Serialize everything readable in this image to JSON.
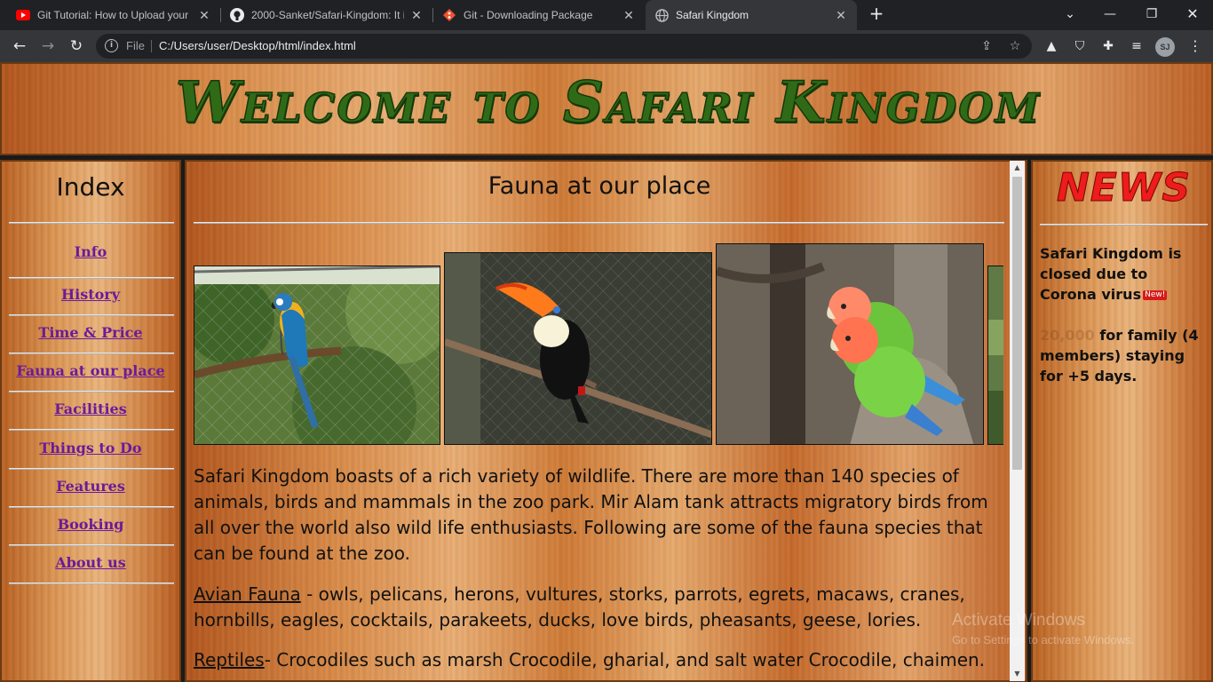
{
  "browser": {
    "tabs": [
      {
        "title": "Git Tutorial: How to Upload your",
        "icon": "youtube-icon",
        "active": false
      },
      {
        "title": "2000-Sanket/Safari-Kingdom: It i",
        "icon": "github-icon",
        "active": false
      },
      {
        "title": "Git - Downloading Package",
        "icon": "git-icon",
        "active": false
      },
      {
        "title": "Safari Kingdom",
        "icon": "globe-icon",
        "active": true
      }
    ],
    "address": {
      "scheme_label": "File",
      "url": "C:/Users/user/Desktop/html/index.html"
    },
    "profile_initials": "SJ"
  },
  "page": {
    "header_title": "Welcome to Safari Kingdom",
    "index": {
      "title": "Index",
      "links": [
        "Info",
        "History",
        "Time & Price",
        "Fauna at our place",
        "Facilities",
        "Things to Do",
        "Features",
        "Booking",
        "About us"
      ]
    },
    "main": {
      "title": "Fauna at our place",
      "intro": "Safari Kingdom boasts of a rich variety of wildlife. There are more than 140 species of animals, birds and mammals in the zoo park. Mir Alam tank attracts migratory birds from all over the world also wild life enthusiasts. Following are some of the fauna species that can be found at the zoo.",
      "avian_label": "Avian Fauna",
      "avian_text": " - owls, pelicans, herons, vultures, storks, parrots, egrets, macaws, cranes, hornbills, eagles, cocktails, parakeets, ducks, love birds, pheasants, geese, lories.",
      "reptiles_label": "Reptiles",
      "reptiles_text": "- Crocodiles such as marsh Crocodile, gharial, and salt water Crocodile, chaimen."
    },
    "news": {
      "title": "NEWS",
      "item1": "Safari Kingdom is closed due to Corona virus",
      "badge": "New!",
      "price": "20,000",
      "item2": " for family (4 members) staying for +5 days."
    }
  },
  "os_watermark": {
    "line1": "Activate Windows",
    "line2": "Go to Settings to activate Windows."
  }
}
